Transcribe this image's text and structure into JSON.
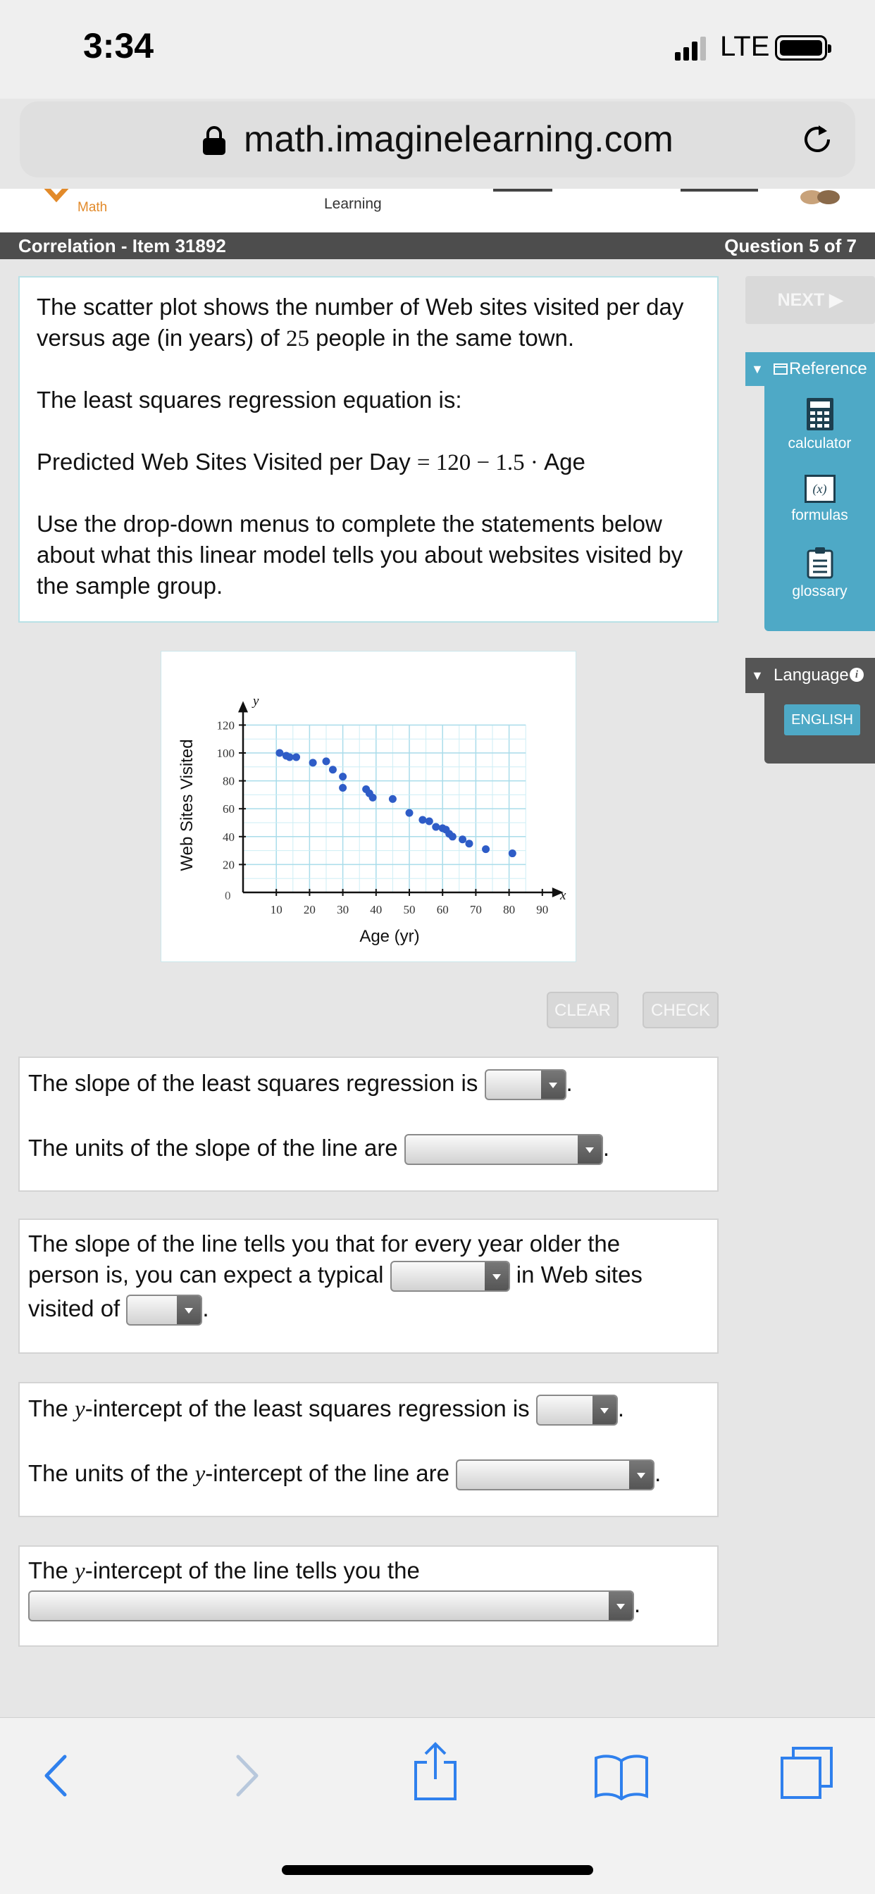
{
  "status": {
    "time": "3:34",
    "network": "LTE"
  },
  "browser": {
    "url": "math.imaginelearning.com",
    "icons": [
      "lock-icon",
      "reload-icon"
    ]
  },
  "site_header": {
    "brand": "Math",
    "learning": "Learning"
  },
  "item_bar": {
    "title": "Correlation - Item 31892",
    "question_count": "Question 5 of 7"
  },
  "question": {
    "p1a": "The scatter plot shows the number of Web sites visited per day",
    "p1b_pre": "versus age (in years) of ",
    "p1b_num": "25",
    "p1b_post": " people in the same town.",
    "p2": "The least squares regression equation is:",
    "p3_pre": "Predicted Web Sites Visited per Day ",
    "p3_eq": "= 120 − 1.5 · ",
    "p3_post": "Age",
    "p4a": "Use the drop-down menus to complete the statements below",
    "p4b": "about what this linear model tells you about websites visited by",
    "p4c": "the sample group."
  },
  "sidebar": {
    "next": "NEXT ▶",
    "reference": "Reference",
    "items": [
      {
        "label": "calculator",
        "icon": "calculator-icon"
      },
      {
        "label": "formulas",
        "icon": "formulas-icon",
        "glyph": "(x)"
      },
      {
        "label": "glossary",
        "icon": "glossary-icon"
      }
    ],
    "language": "Language",
    "english": "ENGLISH"
  },
  "chart_data": {
    "type": "scatter",
    "xlabel": "Age (yr)",
    "ylabel": "Web Sites Visited",
    "x_var": "x",
    "y_var": "y",
    "xlim": [
      0,
      90
    ],
    "ylim": [
      0,
      120
    ],
    "x_ticks": [
      10,
      20,
      30,
      40,
      50,
      60,
      70,
      80,
      90
    ],
    "y_ticks": [
      20,
      40,
      60,
      80,
      100,
      120
    ],
    "origin_label": "0",
    "grid": true,
    "points": [
      [
        11,
        100
      ],
      [
        13,
        98
      ],
      [
        14,
        97
      ],
      [
        16,
        97
      ],
      [
        21,
        93
      ],
      [
        25,
        94
      ],
      [
        27,
        88
      ],
      [
        30,
        83
      ],
      [
        30,
        75
      ],
      [
        37,
        74
      ],
      [
        38,
        71
      ],
      [
        39,
        68
      ],
      [
        45,
        67
      ],
      [
        50,
        57
      ],
      [
        54,
        52
      ],
      [
        56,
        51
      ],
      [
        58,
        47
      ],
      [
        60,
        46
      ],
      [
        61,
        45
      ],
      [
        62,
        42
      ],
      [
        63,
        40
      ],
      [
        66,
        38
      ],
      [
        68,
        35
      ],
      [
        73,
        31
      ],
      [
        81,
        28
      ]
    ]
  },
  "buttons": {
    "clear": "CLEAR",
    "check": "CHECK"
  },
  "answers": {
    "card1": {
      "slope_pre": "The slope of the least squares regression is",
      "units_pre": "The units of the slope of the line are"
    },
    "card2": {
      "l1": "The slope of the line tells you that for every year older the",
      "l2_pre": "person is, you can expect a typical",
      "l2_post": "in Web sites",
      "l3_pre": "visited of"
    },
    "card3": {
      "int_a": "The ",
      "y": "y",
      "int_b": "-intercept of the least squares regression is",
      "units_a": "The units of the ",
      "units_b": "-intercept of the line are"
    },
    "card4": {
      "l1_a": "The ",
      "y": "y",
      "l1_b": "-intercept of the line tells you the"
    },
    "period": "."
  }
}
